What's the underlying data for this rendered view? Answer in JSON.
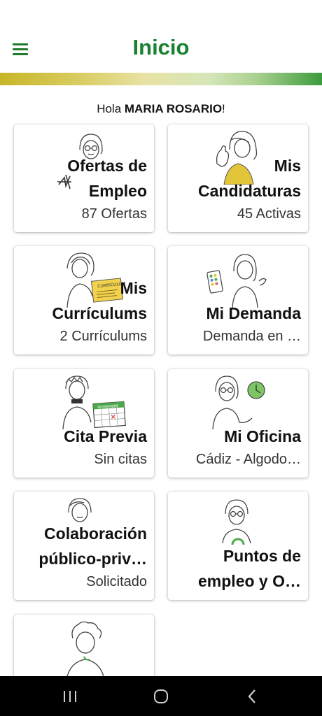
{
  "header": {
    "title": "Inicio"
  },
  "greeting": {
    "prefix": "Hola ",
    "name": "MARIA ROSARIO",
    "suffix": "!"
  },
  "cards": [
    {
      "title_l1": "Ofertas de",
      "title_l2": "Empleo",
      "subtitle": "87 Ofertas"
    },
    {
      "title_l1": "Mis",
      "title_l2": "Candidaturas",
      "subtitle": "45 Activas"
    },
    {
      "title_l1": "Mis",
      "title_l2": "Currículums",
      "subtitle": "2 Currículums"
    },
    {
      "title_l1": "Mi Demanda",
      "subtitle": "Demanda en …"
    },
    {
      "title_l1": "Cita Previa",
      "subtitle": "Sin citas"
    },
    {
      "title_l1": "Mi Oficina",
      "subtitle": "Cádiz - Algodo…"
    },
    {
      "title_l1": "Colaboración",
      "title_l2": "público-priv…",
      "subtitle": "Solicitado"
    },
    {
      "title_l1": "Puntos de",
      "title_l2": "empleo y O…"
    },
    {}
  ],
  "illustration_labels": {
    "curriculum_doc": "CURRICULUM",
    "calendar": "NOVIEMBRE"
  },
  "colors": {
    "brand_green": "#17812f",
    "accent_yellow": "#e3c53a"
  }
}
